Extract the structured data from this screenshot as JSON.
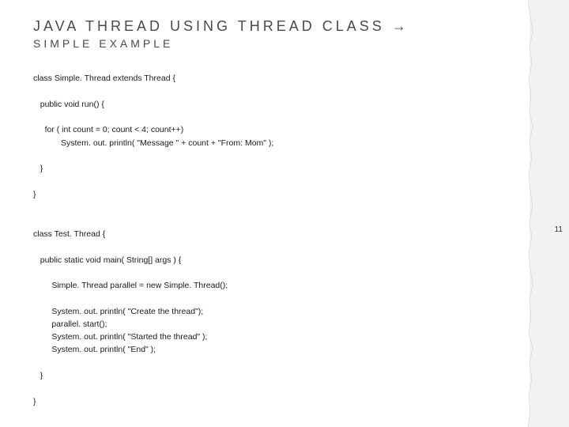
{
  "title": "JAVA THREAD USING THREAD CLASS →",
  "subtitle": "SIMPLE EXAMPLE",
  "page_number": "11",
  "code1": "class Simple. Thread extends Thread {\n\n   public void run() {\n\n     for ( int count = 0; count < 4; count++)\n            System. out. println( \"Message \" + count + \"From: Mom\" );\n\n   }\n\n}",
  "code2": "class Test. Thread {\n\n   public static void main( String[] args ) {\n\n        Simple. Thread parallel = new Simple. Thread();\n\n        System. out. println( \"Create the thread\");\n        parallel. start();\n        System. out. println( \"Started the thread\" );\n        System. out. println( \"End\" );\n\n   }\n\n}"
}
